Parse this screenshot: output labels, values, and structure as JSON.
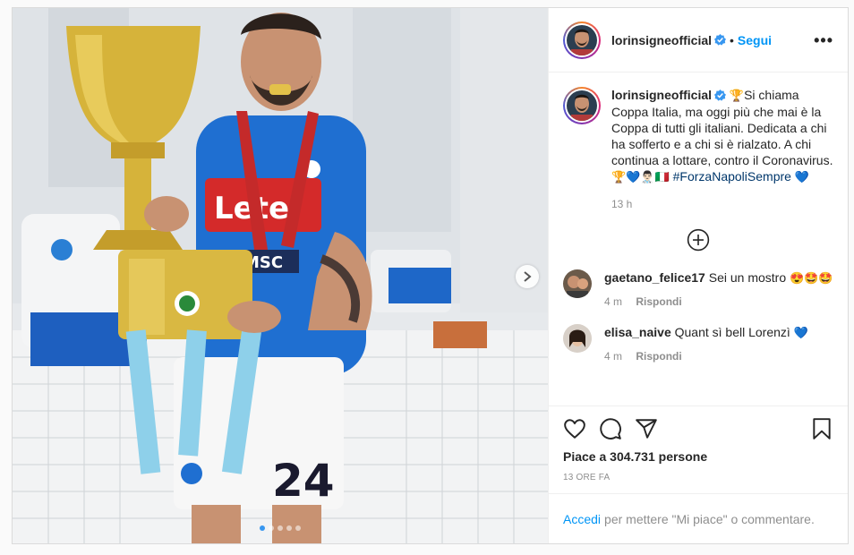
{
  "header": {
    "username": "lorinsigneofficial",
    "separator": "•",
    "follow_label": "Segui",
    "more_label": "•••"
  },
  "caption": {
    "username": "lorinsigneofficial",
    "text_pre": "Si chiama Coppa Italia, ma oggi più che mai è la Coppa di tutti gli italiani. Dedicata a chi ha sofferto e a chi si è rialzato. A chi continua a lottare, contro il Coronavirus.",
    "emojis_mid": "🏆💙👨🏻‍⚕️🇮🇹",
    "hashtag": "#ForzaNapoliSempre",
    "emoji_end": "💙",
    "time": "13 h"
  },
  "comments": [
    {
      "username": "gaetano_felice17",
      "text": "Sei un mostro",
      "emoji": "😍🤩🤩",
      "time": "4 m",
      "reply": "Rispondi"
    },
    {
      "username": "elisa_naive",
      "text": "Quant sì bell Lorenzì",
      "emoji": "💙",
      "time": "4 m",
      "reply": "Rispondi"
    }
  ],
  "likes": "Piace a 304.731 persone",
  "timestamp": "13 ORE FA",
  "login": {
    "link": "Accedi",
    "text": "per mettere \"Mi piace\" o commentare."
  },
  "carousel": {
    "dot_count": 5,
    "active_index": 0
  },
  "colors": {
    "link": "#0095f6",
    "jersey": "#1f6fd1",
    "trophy": "#d6b33a",
    "verified": "#3897f0"
  },
  "icons": [
    "heart-icon",
    "comment-icon",
    "share-icon",
    "bookmark-icon",
    "plus-circle-icon",
    "chevron-right-icon",
    "verified-icon",
    "more-icon"
  ]
}
